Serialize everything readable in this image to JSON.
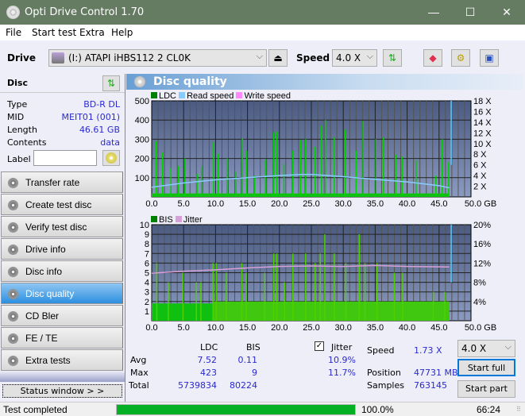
{
  "window": {
    "title": "Opti Drive Control 1.70",
    "minimize": "—",
    "maximize": "☐",
    "close": "✕"
  },
  "menu": [
    "File",
    "Start test",
    "Extra",
    "Help"
  ],
  "toolbar": {
    "drive_label": "Drive",
    "drive_value": "(I:)  ATAPI iHBS112  2 CL0K",
    "speed_label": "Speed",
    "speed_value": "4.0 X"
  },
  "disc": {
    "header": "Disc",
    "rows": [
      {
        "label": "Type",
        "value": "BD-R DL"
      },
      {
        "label": "MID",
        "value": "MEIT01 (001)"
      },
      {
        "label": "Length",
        "value": "46.61 GB"
      },
      {
        "label": "Contents",
        "value": "data"
      }
    ],
    "label_field": "Label",
    "label_value": ""
  },
  "nav": [
    {
      "label": "Transfer rate",
      "active": false
    },
    {
      "label": "Create test disc",
      "active": false
    },
    {
      "label": "Verify test disc",
      "active": false
    },
    {
      "label": "Drive info",
      "active": false
    },
    {
      "label": "Disc info",
      "active": false
    },
    {
      "label": "Disc quality",
      "active": true
    },
    {
      "label": "CD Bler",
      "active": false
    },
    {
      "label": "FE / TE",
      "active": false
    },
    {
      "label": "Extra tests",
      "active": false
    }
  ],
  "status_window_btn": "Status window > >",
  "panel_title": "Disc quality",
  "chart_data": [
    {
      "type": "bar",
      "title": "LDC / Read speed",
      "legend": [
        "LDC",
        "Read speed",
        "Write speed"
      ],
      "legend_colors": [
        "#008000",
        "#88ccff",
        "#ff88ff"
      ],
      "x_ticks": [
        "0.0",
        "5.0",
        "10.0",
        "15.0",
        "20.0",
        "25.0",
        "30.0",
        "35.0",
        "40.0",
        "45.0",
        "50.0 GB"
      ],
      "y_ticks_left": [
        "500",
        "400",
        "300",
        "200",
        "100"
      ],
      "y_ticks_right": [
        "18 X",
        "16 X",
        "14 X",
        "12 X",
        "10 X",
        "8 X",
        "6 X",
        "4 X",
        "2 X"
      ],
      "xlim": [
        0,
        50
      ],
      "ylim": [
        0,
        500
      ],
      "y2lim": [
        0,
        18
      ],
      "read_speed": {
        "x": [
          0,
          5,
          10,
          15,
          20,
          23.5,
          25,
          30,
          35,
          40,
          45,
          46.6
        ],
        "y": [
          1.8,
          2.6,
          3.2,
          3.6,
          4.0,
          4.2,
          4.2,
          3.8,
          3.3,
          2.8,
          2.1,
          1.7
        ]
      },
      "ldc_peaks": {
        "x": [
          0.7,
          1.7,
          3.0,
          4.2,
          5.2,
          7.1,
          7.8,
          9.7,
          10.4,
          11.8,
          13.2,
          14.2,
          14.9,
          16.1,
          17.8,
          19.1,
          19.6,
          20.7,
          22.1,
          23.3,
          24.1,
          25.6,
          26.6,
          27.2,
          28.6,
          30.3,
          32.0,
          33.1,
          35.1,
          36.3,
          38.2,
          39.2,
          41.4,
          44.5,
          45.5,
          46.5
        ],
        "y": [
          290,
          230,
          150,
          160,
          200,
          120,
          160,
          285,
          225,
          200,
          130,
          305,
          240,
          110,
          195,
          335,
          340,
          170,
          240,
          295,
          300,
          260,
          370,
          400,
          310,
          350,
          240,
          395,
          300,
          310,
          220,
          210,
          190,
          110,
          300,
          180
        ]
      }
    },
    {
      "type": "bar",
      "title": "BIS / Jitter",
      "legend": [
        "BIS",
        "Jitter"
      ],
      "legend_colors": [
        "#008000",
        "#d8a0d8"
      ],
      "x_ticks": [
        "0.0",
        "5.0",
        "10.0",
        "15.0",
        "20.0",
        "25.0",
        "30.0",
        "35.0",
        "40.0",
        "45.0",
        "50.0 GB"
      ],
      "y_ticks_left": [
        "10",
        "9",
        "8",
        "7",
        "6",
        "5",
        "4",
        "3",
        "2",
        "1"
      ],
      "y_ticks_right": [
        "20%",
        "16%",
        "12%",
        "8%",
        "4%"
      ],
      "xlim": [
        0,
        50
      ],
      "ylim": [
        0,
        10
      ],
      "y2lim": [
        0,
        20
      ],
      "jitter": {
        "x": [
          0,
          5,
          10,
          15,
          20,
          25,
          30,
          35,
          40,
          46.6
        ],
        "y": [
          9.9,
          10.3,
          10.6,
          11.0,
          11.3,
          11.4,
          11.3,
          11.5,
          11.3,
          11.2
        ]
      },
      "bis_peaks": {
        "x": [
          0.8,
          2.6,
          4.9,
          7.0,
          7.7,
          9.6,
          10.1,
          11.7,
          14.1,
          14.8,
          17.7,
          19.1,
          19.6,
          20.8,
          22.1,
          24.1,
          25.6,
          26.4,
          27.1,
          28.6,
          30.4,
          32.5,
          33.4,
          35.3,
          38.0,
          39.3,
          44.1,
          45.9
        ],
        "y": [
          6,
          4,
          5,
          4,
          4,
          6,
          6,
          5,
          6,
          5,
          5,
          7,
          7,
          4,
          7,
          7,
          6,
          7,
          9,
          7,
          6,
          9,
          6,
          6,
          5,
          5,
          3,
          3
        ]
      }
    }
  ],
  "stats": {
    "col_ldc": "LDC",
    "col_bis": "BIS",
    "rows": [
      {
        "label": "Avg",
        "ldc": "7.52",
        "bis": "0.11"
      },
      {
        "label": "Max",
        "ldc": "423",
        "bis": "9"
      },
      {
        "label": "Total",
        "ldc": "5739834",
        "bis": "80224"
      }
    ],
    "jitter_label": "Jitter",
    "jitter_checked": true,
    "jitter_avg": "10.9%",
    "jitter_max": "11.7%",
    "speed_label": "Speed",
    "speed_value": "1.73 X",
    "position_label": "Position",
    "position_value": "47731 MB",
    "samples_label": "Samples",
    "samples_value": "763145",
    "speed_select": "4.0 X",
    "start_full": "Start full",
    "start_part": "Start part"
  },
  "statusbar": {
    "text": "Test completed",
    "progress": 100.0,
    "progress_label": "100.0%",
    "time": "66:24"
  }
}
